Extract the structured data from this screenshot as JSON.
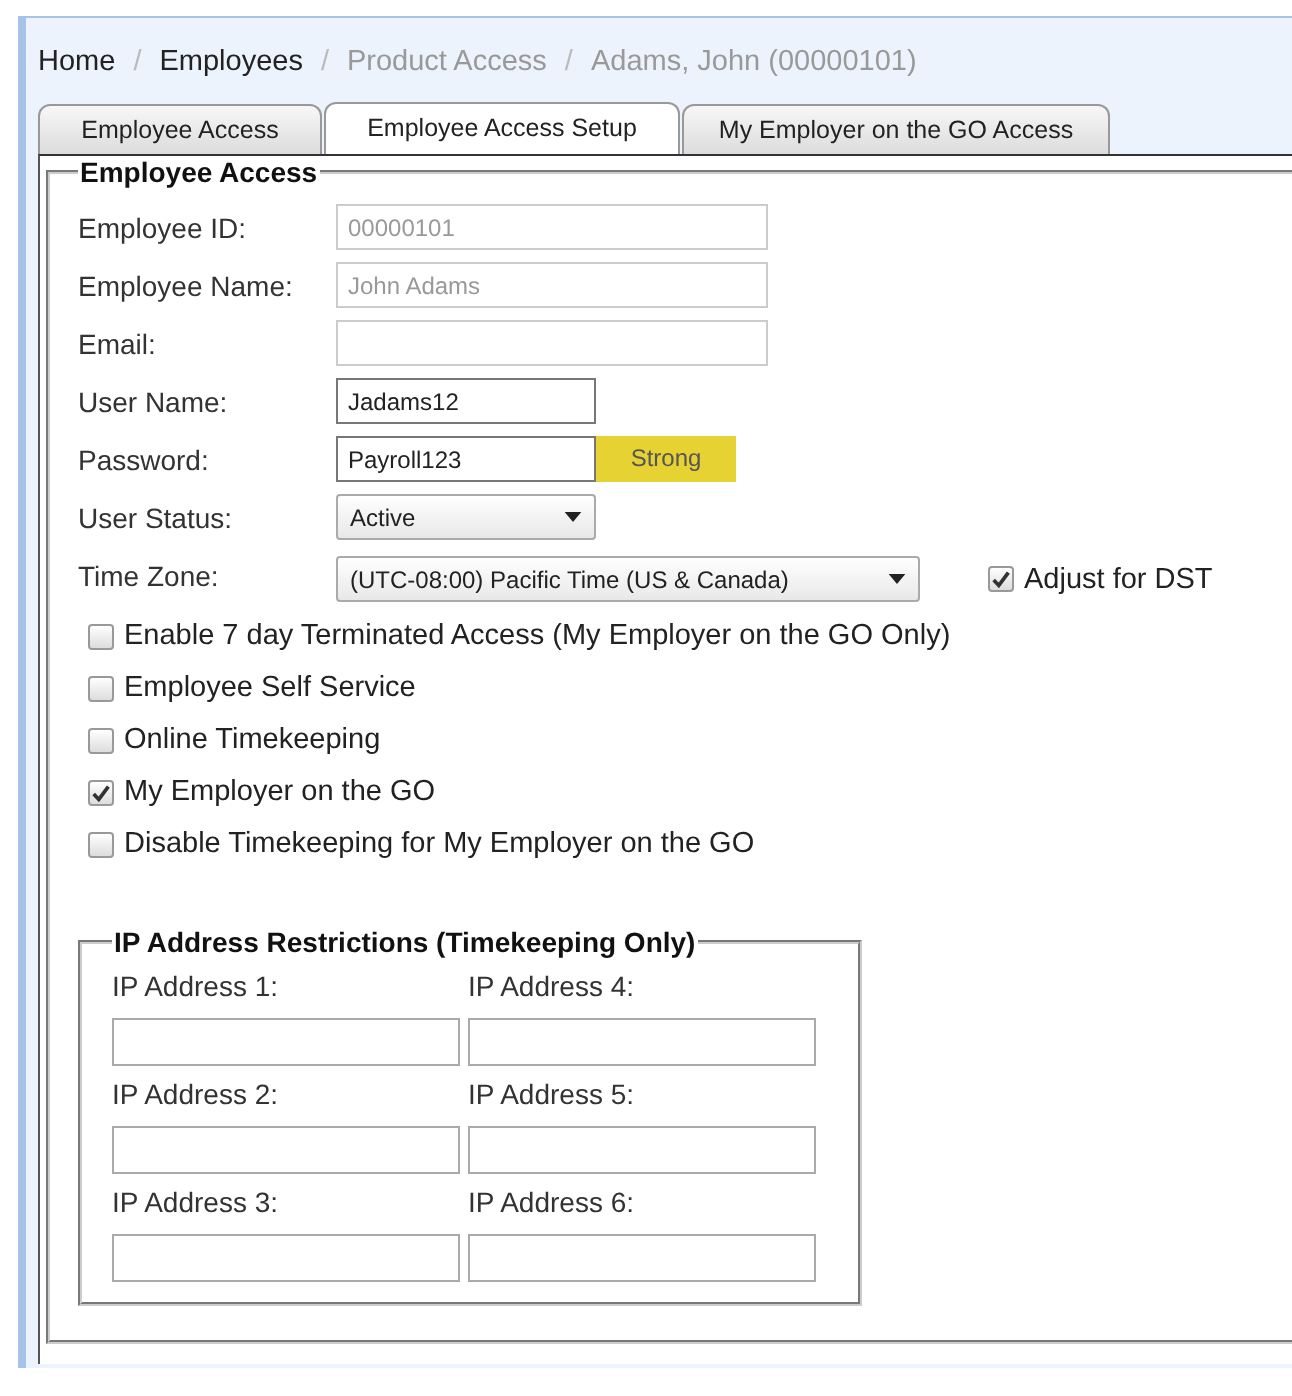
{
  "breadcrumb": {
    "separator": "/",
    "items": [
      {
        "label": "Home",
        "link": true
      },
      {
        "label": "Employees",
        "link": true
      },
      {
        "label": "Product Access",
        "link": false
      },
      {
        "label": "Adams, John (00000101)",
        "link": false
      }
    ]
  },
  "tabs": [
    {
      "label": "Employee Access",
      "selected": false
    },
    {
      "label": "Employee Access Setup",
      "selected": true
    },
    {
      "label": "My Employer on the GO Access",
      "selected": false
    }
  ],
  "section": {
    "title": "Employee Access",
    "fields": [
      {
        "kind": "text",
        "label": "Employee ID:",
        "value": "00000101",
        "disabled": true
      },
      {
        "kind": "text",
        "label": "Employee Name:",
        "value": "John Adams",
        "disabled": true
      },
      {
        "kind": "text",
        "label": "Email:",
        "disabled": true
      },
      {
        "kind": "text",
        "label": "User Name:",
        "value": "Jadams12",
        "disabled": false
      },
      {
        "kind": "password",
        "label": "Password:",
        "value": "Payroll123",
        "disabled": false,
        "strength": "Strong"
      },
      {
        "kind": "select",
        "label": "User Status:",
        "value": "Active"
      },
      {
        "kind": "select",
        "label": "Time Zone:",
        "value": "(UTC-08:00) Pacific Time (US & Canada)",
        "extra": {
          "label": "Adjust for DST",
          "checked": true
        }
      }
    ],
    "checkboxes": [
      {
        "label": "Enable 7 day Terminated Access (My Employer on the GO Only)",
        "checked": false
      },
      {
        "label": "Employee Self Service",
        "checked": false
      },
      {
        "label": "Online Timekeeping",
        "checked": false
      },
      {
        "label": "My Employer on the GO",
        "checked": true
      },
      {
        "label": "Disable Timekeeping for My Employer on the GO",
        "checked": false
      }
    ],
    "ip_restrictions": {
      "title": "IP Address Restrictions (Timekeeping Only)",
      "fields": [
        {
          "label": "IP Address 1:"
        },
        {
          "label": "IP Address 2:"
        },
        {
          "label": "IP Address 3:"
        },
        {
          "label": "IP Address 4:"
        },
        {
          "label": "IP Address 5:"
        },
        {
          "label": "IP Address 6:"
        }
      ]
    }
  }
}
